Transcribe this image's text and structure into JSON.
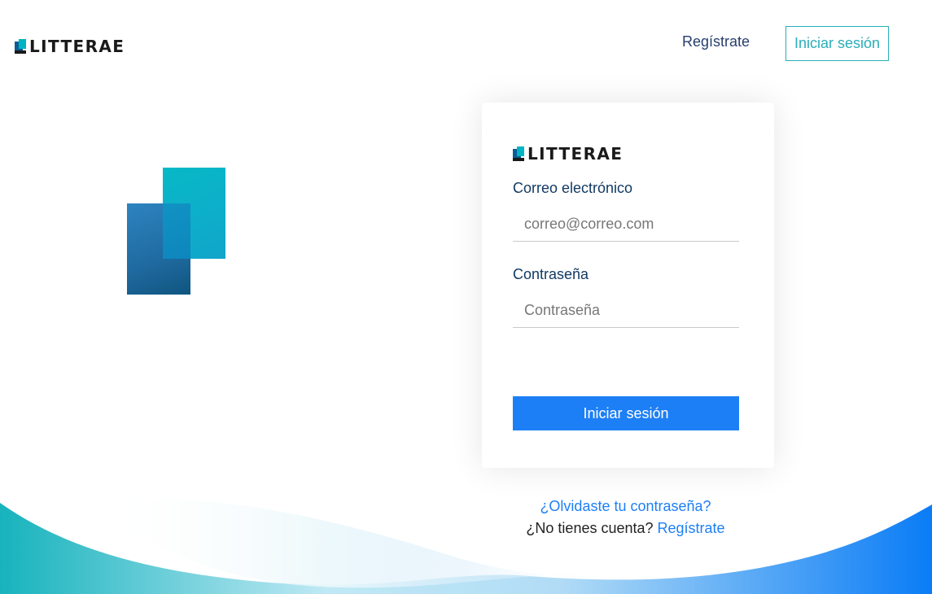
{
  "header": {
    "logo_text": "LITTERAE",
    "register_label": "Regístrate",
    "login_label": "Iniciar sesión"
  },
  "card": {
    "logo_text": "LITTERAE",
    "email": {
      "label": "Correo electrónico",
      "placeholder": "correo@correo.com",
      "value": ""
    },
    "password": {
      "label": "Contraseña",
      "placeholder": "Contraseña",
      "value": ""
    },
    "submit_label": "Iniciar sesión"
  },
  "links": {
    "forgot_password": "¿Olvidaste tu contraseña?",
    "no_account_text": "¿No tienes cuenta?",
    "register_label": "Regístrate"
  },
  "colors": {
    "brand_dark": "#1a1a1a",
    "brand_blue": "#0c5d93",
    "brand_teal": "#00b4c4",
    "accent": "#1d7ff5",
    "outline_button": "#2aaeb9"
  },
  "icons": [
    "litterae-logo-icon",
    "document-stack-illustration"
  ]
}
